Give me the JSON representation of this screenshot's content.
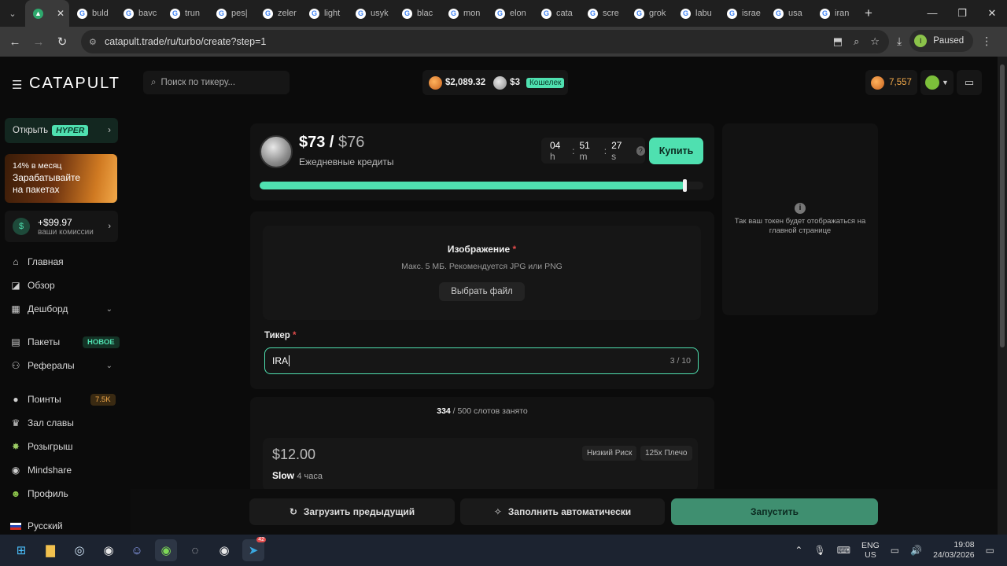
{
  "browser": {
    "tabs": [
      {
        "label": "",
        "active": true
      },
      {
        "label": "buld"
      },
      {
        "label": "bavc"
      },
      {
        "label": "trun"
      },
      {
        "label": "pes|"
      },
      {
        "label": "zeler"
      },
      {
        "label": "light"
      },
      {
        "label": "usyk"
      },
      {
        "label": "blac"
      },
      {
        "label": "mon"
      },
      {
        "label": "elon"
      },
      {
        "label": "cata"
      },
      {
        "label": "scre"
      },
      {
        "label": "grok"
      },
      {
        "label": "labu"
      },
      {
        "label": "israe"
      },
      {
        "label": "usa"
      },
      {
        "label": "iran"
      }
    ],
    "url": "catapult.trade/ru/turbo/create?step=1",
    "profile_status": "Paused",
    "profile_initial": "I"
  },
  "header": {
    "logo": "CATAPULT",
    "search_placeholder": "Поиск по тикеру...",
    "balance_gold": "$2,089.32",
    "balance_silver": "$3",
    "wallet_label": "Кошелек",
    "points": "7,557"
  },
  "sidebar": {
    "hyper_prefix": "Открыть",
    "hyper_badge": "HYPER",
    "promo_line1": "14% в месяц",
    "promo_line2": "Зарабатывайте",
    "promo_line3": "на пакетах",
    "commission_amount": "+$99.97",
    "commission_label": "ваши комиссии",
    "items": [
      {
        "label": "Главная",
        "icon": "home-icon"
      },
      {
        "label": "Обзор",
        "icon": "chart-icon"
      },
      {
        "label": "Дешборд",
        "icon": "grid-icon"
      },
      {
        "label": "Пакеты",
        "icon": "package-icon",
        "badge": "НОВОЕ"
      },
      {
        "label": "Рефералы",
        "icon": "users-icon"
      },
      {
        "label": "Поинты",
        "icon": "points-icon",
        "badge": "7.5K"
      },
      {
        "label": "Зал славы",
        "icon": "trophy-icon"
      },
      {
        "label": "Розыгрыш",
        "icon": "giveaway-icon"
      },
      {
        "label": "Mindshare",
        "icon": "mindshare-icon"
      },
      {
        "label": "Профиль",
        "icon": "profile-icon"
      }
    ],
    "language": "Русский"
  },
  "credits": {
    "current": "$73",
    "separator": " / ",
    "max": "$76",
    "label": "Ежедневные кредиты",
    "timer_h": "04",
    "timer_m": "51",
    "timer_s": "27",
    "buy_label": "Купить",
    "progress_fraction": 0.96
  },
  "form": {
    "image_title": "Изображение",
    "image_hint": "Макс. 5 МБ. Рекомендуется JPG или PNG",
    "choose_file": "Выбрать файл",
    "ticker_label": "Тикер",
    "ticker_value": "IRA",
    "ticker_count": "3 / 10"
  },
  "preview": {
    "hint": "Так ваш токен будет отображаться на главной странице"
  },
  "slots": {
    "taken": "334",
    "total_text": " / 500 слотов занято"
  },
  "plan": {
    "price": "$12.00",
    "speed": "Slow",
    "duration": "4 часа",
    "risk": "Низкий Риск",
    "leverage": "125x Плечо"
  },
  "actions": {
    "load_prev": "Загрузить предыдущий",
    "autofill": "Заполнить автоматически",
    "launch": "Запустить"
  },
  "taskbar": {
    "lang_top": "ENG",
    "lang_bottom": "US",
    "time": "19:08",
    "date": "24/03/2026",
    "telegram_badge": "42"
  }
}
